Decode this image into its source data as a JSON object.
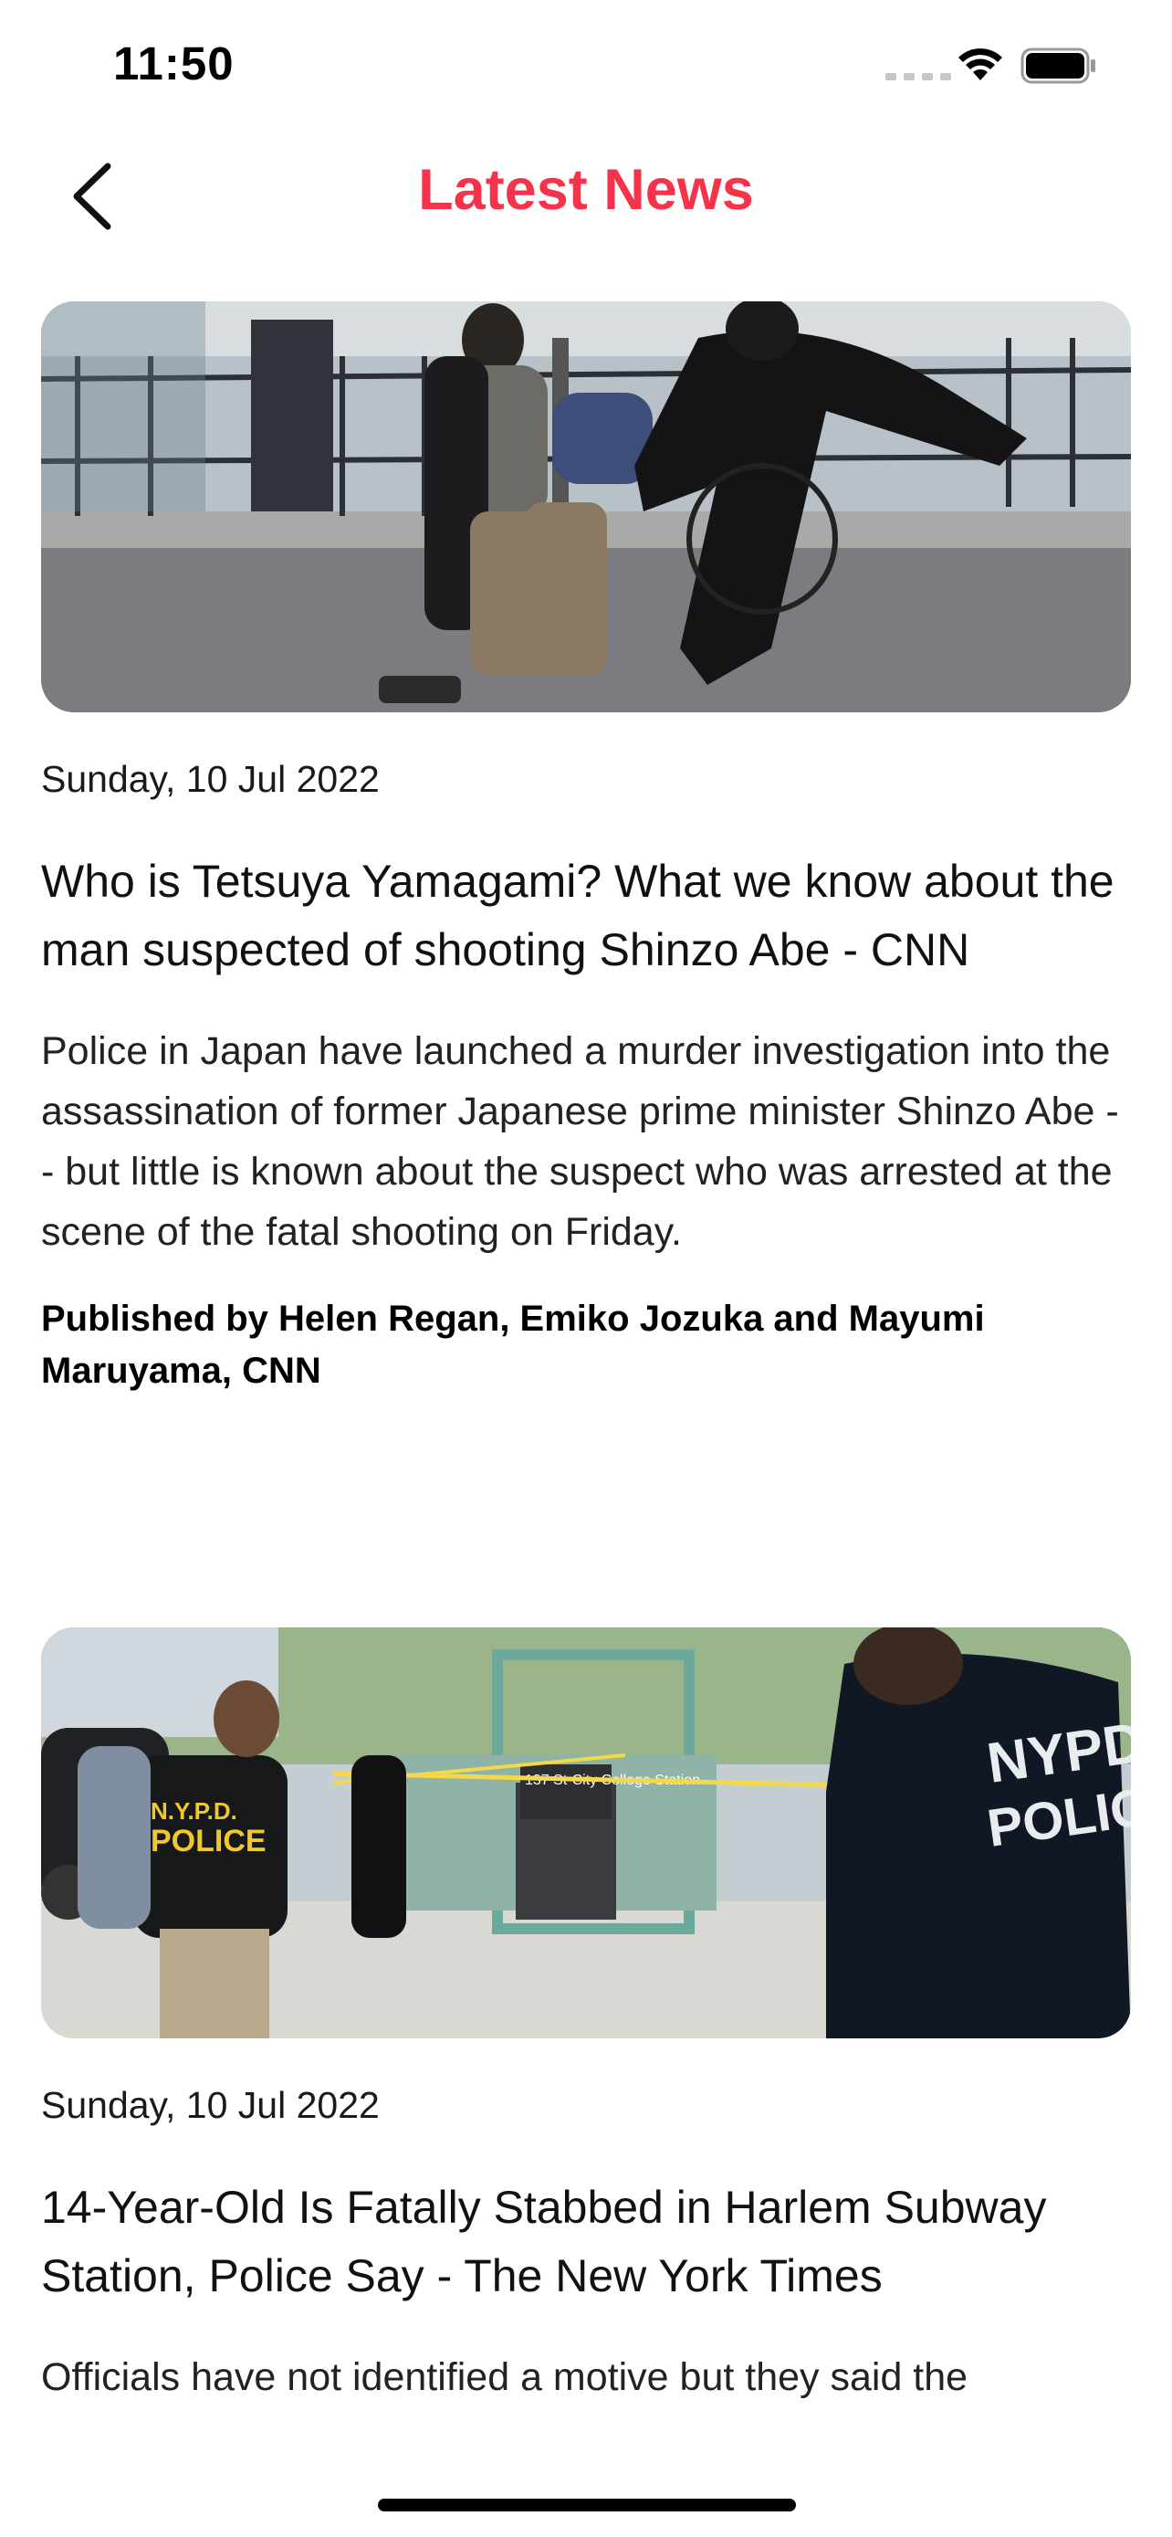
{
  "status_bar": {
    "time": "11:50",
    "icons": [
      "cellular-signal-icon",
      "wifi-icon",
      "battery-icon"
    ]
  },
  "header": {
    "title": "Latest News",
    "back_icon": "chevron-left-icon",
    "title_color": "#f5334a"
  },
  "articles": [
    {
      "image_description_icon": "news-photo",
      "date": "Sunday, 10 Jul 2022",
      "title": "Who is Tetsuya Yamagami? What we know about the man suspected of shooting Shinzo Abe - CNN",
      "description": "Police in Japan have launched a murder investigation into the assassination of former Japanese prime minister Shinzo Abe -- but little is known about the suspect who was arrested at the scene of the fatal shooting on Friday.",
      "author": "Published by Helen Regan, Emiko Jozuka and Mayumi Maruyama, CNN"
    },
    {
      "image_description_icon": "news-photo",
      "image_text": {
        "vest": "NYPD POLICE",
        "shirt": "N.Y.P.D. POLICE CRIME SCENE UNIT",
        "sign": "137 St-City College Station"
      },
      "date": "Sunday, 10 Jul 2022",
      "title": "14-Year-Old Is Fatally Stabbed in Harlem Subway Station, Police Say - The New York Times",
      "description": "Officials have not identified a motive but they said the"
    }
  ]
}
